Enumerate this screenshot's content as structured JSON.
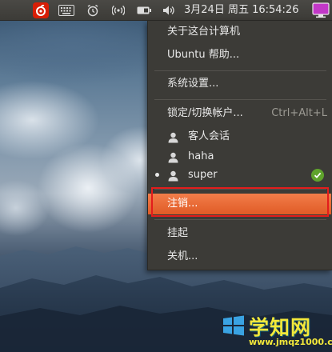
{
  "panel": {
    "clock": "3月24日 周五 16:54:26",
    "icons": [
      "netease-music-icon",
      "keyboard-icon",
      "alarm-clock-icon",
      "wireless-icon",
      "battery-icon",
      "volume-icon",
      "session-monitor-icon"
    ]
  },
  "menu": {
    "about": "关于这台计算机",
    "help": "Ubuntu 帮助...",
    "settings": "系统设置...",
    "lock_switch": "锁定/切换帐户...",
    "lock_shortcut": "Ctrl+Alt+L",
    "users": [
      {
        "name": "客人会话",
        "current": false
      },
      {
        "name": "haha",
        "current": false
      },
      {
        "name": "super",
        "current": true
      }
    ],
    "logout": "注销...",
    "suspend": "挂起",
    "shutdown": "关机..."
  },
  "watermark": {
    "title": "学知网",
    "url": "www.jmqz1000.com"
  },
  "colors": {
    "panel": "#3c3b37",
    "menu_bg": "#3c3b37",
    "highlight": "#e05b26",
    "annotation": "#e31c1c",
    "check": "#5fa32c"
  }
}
